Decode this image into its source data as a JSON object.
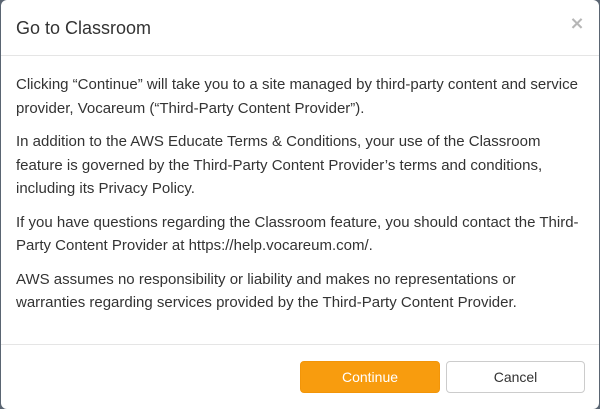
{
  "dialog": {
    "title": "Go to Classroom",
    "close_glyph": "×",
    "paragraphs": [
      "Clicking “Continue” will take you to a site managed by third-party content and service provider, Vocareum (“Third-Party Content Provider”).",
      "In addition to the AWS Educate Terms & Conditions, your use of the Classroom feature is governed by the Third-Party Content Provider’s terms and conditions, including its Privacy Policy.",
      "If you have questions regarding the Classroom feature, you should contact the Third-Party Content Provider at https://help.vocareum.com/.",
      "AWS assumes no responsibility or liability and makes no representations or warranties regarding services provided by the Third-Party Content Provider."
    ],
    "continue_label": "Continue",
    "cancel_label": "Cancel"
  },
  "colors": {
    "primary_button": "#f89c0e",
    "backdrop": "#5a6572"
  },
  "icons": {
    "close": "close-icon"
  }
}
